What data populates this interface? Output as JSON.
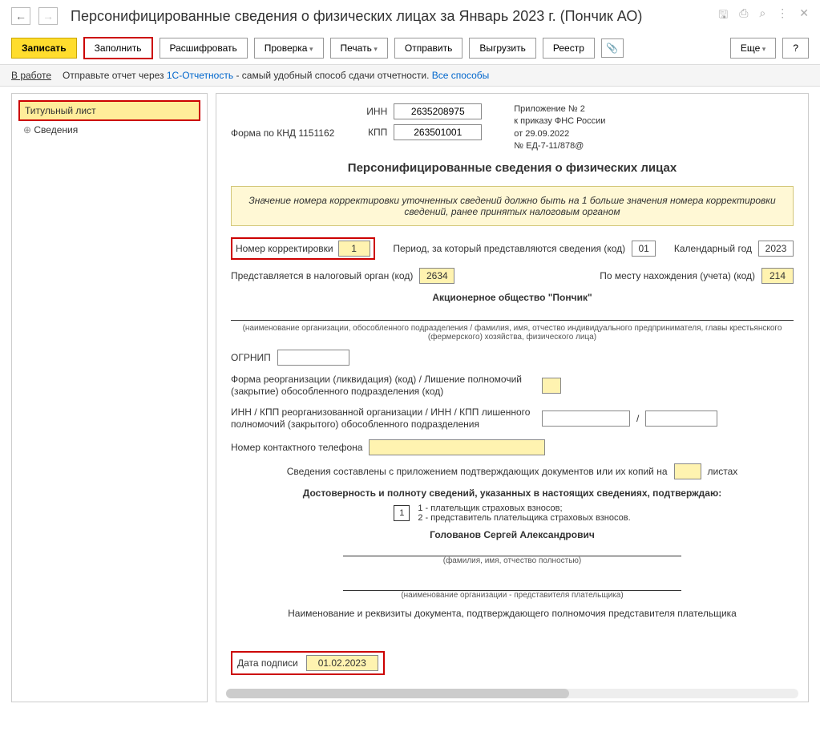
{
  "header": {
    "title": "Персонифицированные сведения о физических лицах за Январь 2023 г. (Пончик АО)"
  },
  "toolbar": {
    "save": "Записать",
    "fill": "Заполнить",
    "decode": "Расшифровать",
    "check": "Проверка",
    "print": "Печать",
    "send": "Отправить",
    "export": "Выгрузить",
    "registry": "Реестр",
    "more": "Еще",
    "help": "?"
  },
  "infobar": {
    "status": "В работе",
    "hint_pre": "Отправьте отчет через ",
    "link1": "1С-Отчетность",
    "hint_mid": " - самый удобный способ сдачи отчетности. ",
    "link2": "Все способы"
  },
  "sidebar": {
    "item1": "Титульный лист",
    "item2": "Сведения"
  },
  "form": {
    "knd": "Форма по КНД 1151162",
    "inn_label": "ИНН",
    "inn": "2635208975",
    "kpp_label": "КПП",
    "kpp": "263501001",
    "appendix_l1": "Приложение № 2",
    "appendix_l2": "к приказу ФНС России",
    "appendix_l3": "от 29.09.2022",
    "appendix_l4": "№ ЕД-7-11/878@",
    "title": "Персонифицированные сведения о физических лицах",
    "notice": "Значение номера корректировки уточненных сведений должно быть на 1 больше значения номера корректировки сведений, ранее принятых налоговым органом",
    "corr_label": "Номер корректировки",
    "corr": "1",
    "period_label": "Период, за который представляются сведения (код)",
    "period": "01",
    "year_label": "Календарный год",
    "year": "2023",
    "tax_org_label": "Представляется в налоговый орган (код)",
    "tax_org": "2634",
    "place_label": "По месту нахождения (учета) (код)",
    "place": "214",
    "org_name": "Акционерное общество \"Пончик\"",
    "org_name_note": "(наименование организации, обособленного подразделения / фамилия, имя, отчество индивидуального предпринимателя, главы крестьянского (фермерского) хозяйства, физического лица)",
    "ogrnip_label": "ОГРНИП",
    "reorg_label": "Форма реорганизации (ликвидация) (код) / Лишение полномочий (закрытие) обособленного подразделения (код)",
    "reorg_inn_label": "ИНН / КПП реорганизованной организации / ИНН / КПП лишенного полномочий (закрытого) обособленного подразделения",
    "phone_label": "Номер контактного телефона",
    "pages_label_pre": "Сведения составлены с приложением подтверждающих документов или их копий на",
    "pages_label_post": "листах",
    "confirm_title": "Достоверность и полноту сведений, указанных в настоящих сведениях, подтверждаю:",
    "signer_code": "1",
    "signer_opt1": "1 - плательщик страховых взносов;",
    "signer_opt2": "2 - представитель плательщика страховых взносов.",
    "signer_name": "Голованов Сергей Александрович",
    "signer_name_note": "(фамилия, имя, отчество полностью)",
    "repr_org_note": "(наименование организации - представителя плательщика)",
    "doc_title": "Наименование и реквизиты документа, подтверждающего полномочия представителя плательщика",
    "date_label": "Дата подписи",
    "date": "01.02.2023"
  }
}
